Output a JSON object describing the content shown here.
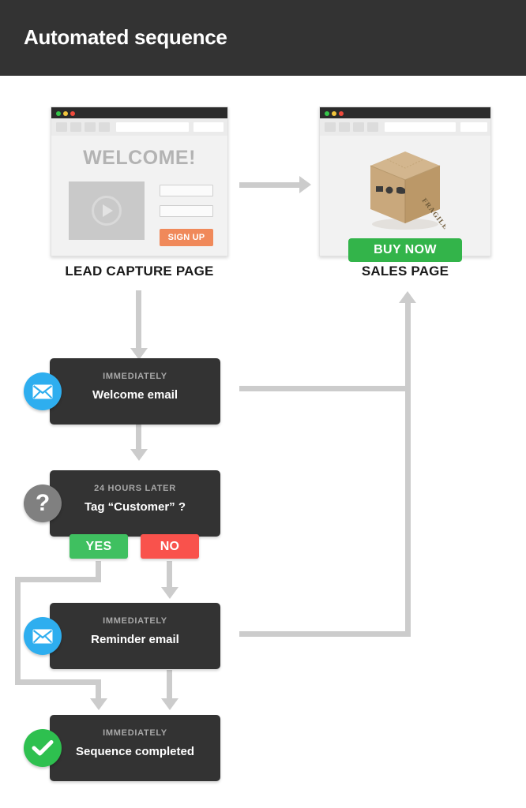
{
  "header": {
    "title": "Automated sequence"
  },
  "pages": {
    "lead_capture": {
      "label": "LEAD CAPTURE PAGE",
      "heading": "WELCOME!",
      "cta_label": "SIGN UP",
      "cta_color": "#f0895a",
      "video_icon": "play-icon",
      "field_count": 2
    },
    "sales": {
      "label": "SALES PAGE",
      "cta_label": "BUY NOW",
      "cta_color": "#33b44a",
      "product_icon": "cardboard-box-icon",
      "product_marking": "FRAGILE"
    }
  },
  "flow": {
    "nodes": [
      {
        "id": "welcome-email",
        "eyebrow": "IMMEDIATELY",
        "title": "Welcome email",
        "icon": "envelope-icon",
        "icon_color": "#2eaeef"
      },
      {
        "id": "tag-customer",
        "eyebrow": "24 HOURS LATER",
        "title": "Tag “Customer” ?",
        "icon": "question-mark-icon",
        "icon_color": "#808080"
      },
      {
        "id": "reminder-email",
        "eyebrow": "IMMEDIATELY",
        "title": "Reminder email",
        "icon": "envelope-icon",
        "icon_color": "#2eaeef"
      },
      {
        "id": "sequence-completed",
        "eyebrow": "IMMEDIATELY",
        "title": "Sequence completed",
        "icon": "checkmark-icon",
        "icon_color": "#2ec04f"
      }
    ],
    "branches": {
      "yes_label": "YES",
      "yes_color": "#3fc060",
      "no_label": "NO",
      "no_color": "#f9524c"
    },
    "connector_color": "#cccccc"
  }
}
